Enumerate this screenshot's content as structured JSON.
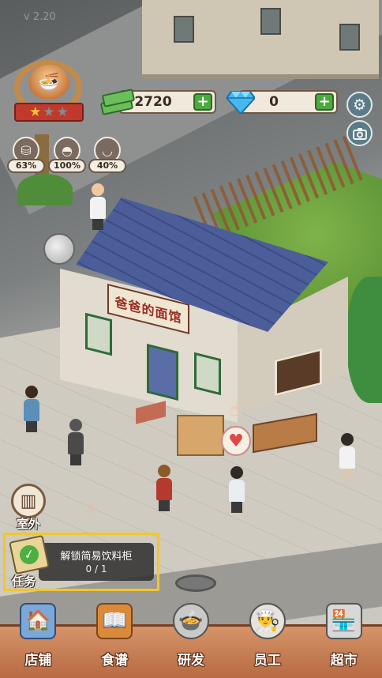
{
  "version": "v 2.20",
  "shop_sign": "爸爸的面馆",
  "rank": {
    "stars_filled": 1,
    "stars_total": 3,
    "icon": "noodle-bowl-icon"
  },
  "stats": [
    {
      "name": "comfort",
      "icon": "armchair-icon",
      "value": "63%"
    },
    {
      "name": "food",
      "icon": "cloche-icon",
      "value": "100%"
    },
    {
      "name": "noodles",
      "icon": "noodle-bowl-icon",
      "value": "40%"
    }
  ],
  "currencies": {
    "cash": {
      "icon": "cash-icon",
      "amount": "2720"
    },
    "diamond": {
      "icon": "diamond-icon",
      "amount": "0"
    }
  },
  "buttons": {
    "settings_icon": "gear-icon",
    "camera_icon": "camera-icon"
  },
  "outdoor": {
    "label": "室外",
    "icon": "door-icon"
  },
  "task": {
    "label": "任务",
    "title": "解锁简易饮料柜",
    "progress": "0 / 1",
    "highlight_color": "#f3c728"
  },
  "nav": [
    {
      "key": "shop",
      "label": "店铺",
      "icon": "storefront-icon"
    },
    {
      "key": "recipes",
      "label": "食谱",
      "icon": "recipe-book-icon"
    },
    {
      "key": "research",
      "label": "研发",
      "icon": "cooking-pot-icon"
    },
    {
      "key": "staff",
      "label": "员工",
      "icon": "staff-icon"
    },
    {
      "key": "market",
      "label": "超市",
      "icon": "supermarket-icon"
    }
  ],
  "colors": {
    "accent_green": "#4ca93e",
    "nav_wood": "#c47a50",
    "roof_blue": "#4b5e9a",
    "heart_red": "#e04848"
  }
}
